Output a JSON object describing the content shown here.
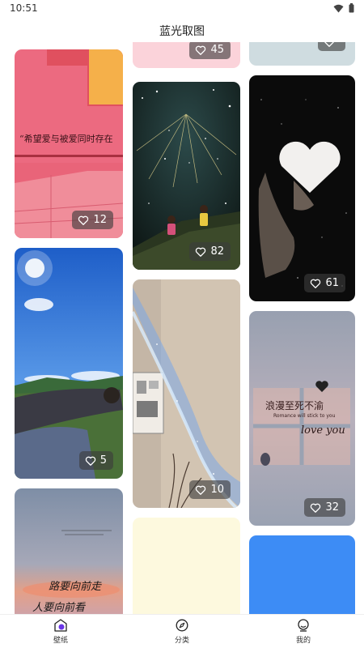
{
  "status": {
    "time": "10:51",
    "icons": [
      "wifi-icon",
      "battery-icon"
    ]
  },
  "app": {
    "title": "蓝光取图"
  },
  "cards": [
    {
      "name": "card-top-center",
      "likes": "45"
    },
    {
      "name": "card-top-right",
      "likes": ""
    },
    {
      "name": "card-pink-wall",
      "likes": "12",
      "caption": "“希望爱与被爱同时存在"
    },
    {
      "name": "card-starry-kids",
      "likes": "82"
    },
    {
      "name": "card-heart-hand",
      "likes": "61"
    },
    {
      "name": "card-sky-lying",
      "likes": "5"
    },
    {
      "name": "card-galaxy-room",
      "likes": "10"
    },
    {
      "name": "card-love-you",
      "likes": "32",
      "caption_main": "浪漫至死不渝",
      "caption_small": "Romance will stick to you",
      "caption_en": "love you"
    },
    {
      "name": "card-sunset-text",
      "likes": "",
      "caption_main": "路要向前走",
      "caption_sub": "人要向前看"
    },
    {
      "name": "card-cream",
      "likes": ""
    },
    {
      "name": "card-blue",
      "likes": ""
    }
  ],
  "nav": {
    "items": [
      {
        "label": "壁纸",
        "icon": "wallpaper-icon",
        "active": true
      },
      {
        "label": "分类",
        "icon": "compass-icon",
        "active": false
      },
      {
        "label": "我的",
        "icon": "profile-icon",
        "active": false
      }
    ]
  },
  "colors": {
    "accent": "#6a35e6",
    "like_badge_bg": "#3c3c3c"
  }
}
